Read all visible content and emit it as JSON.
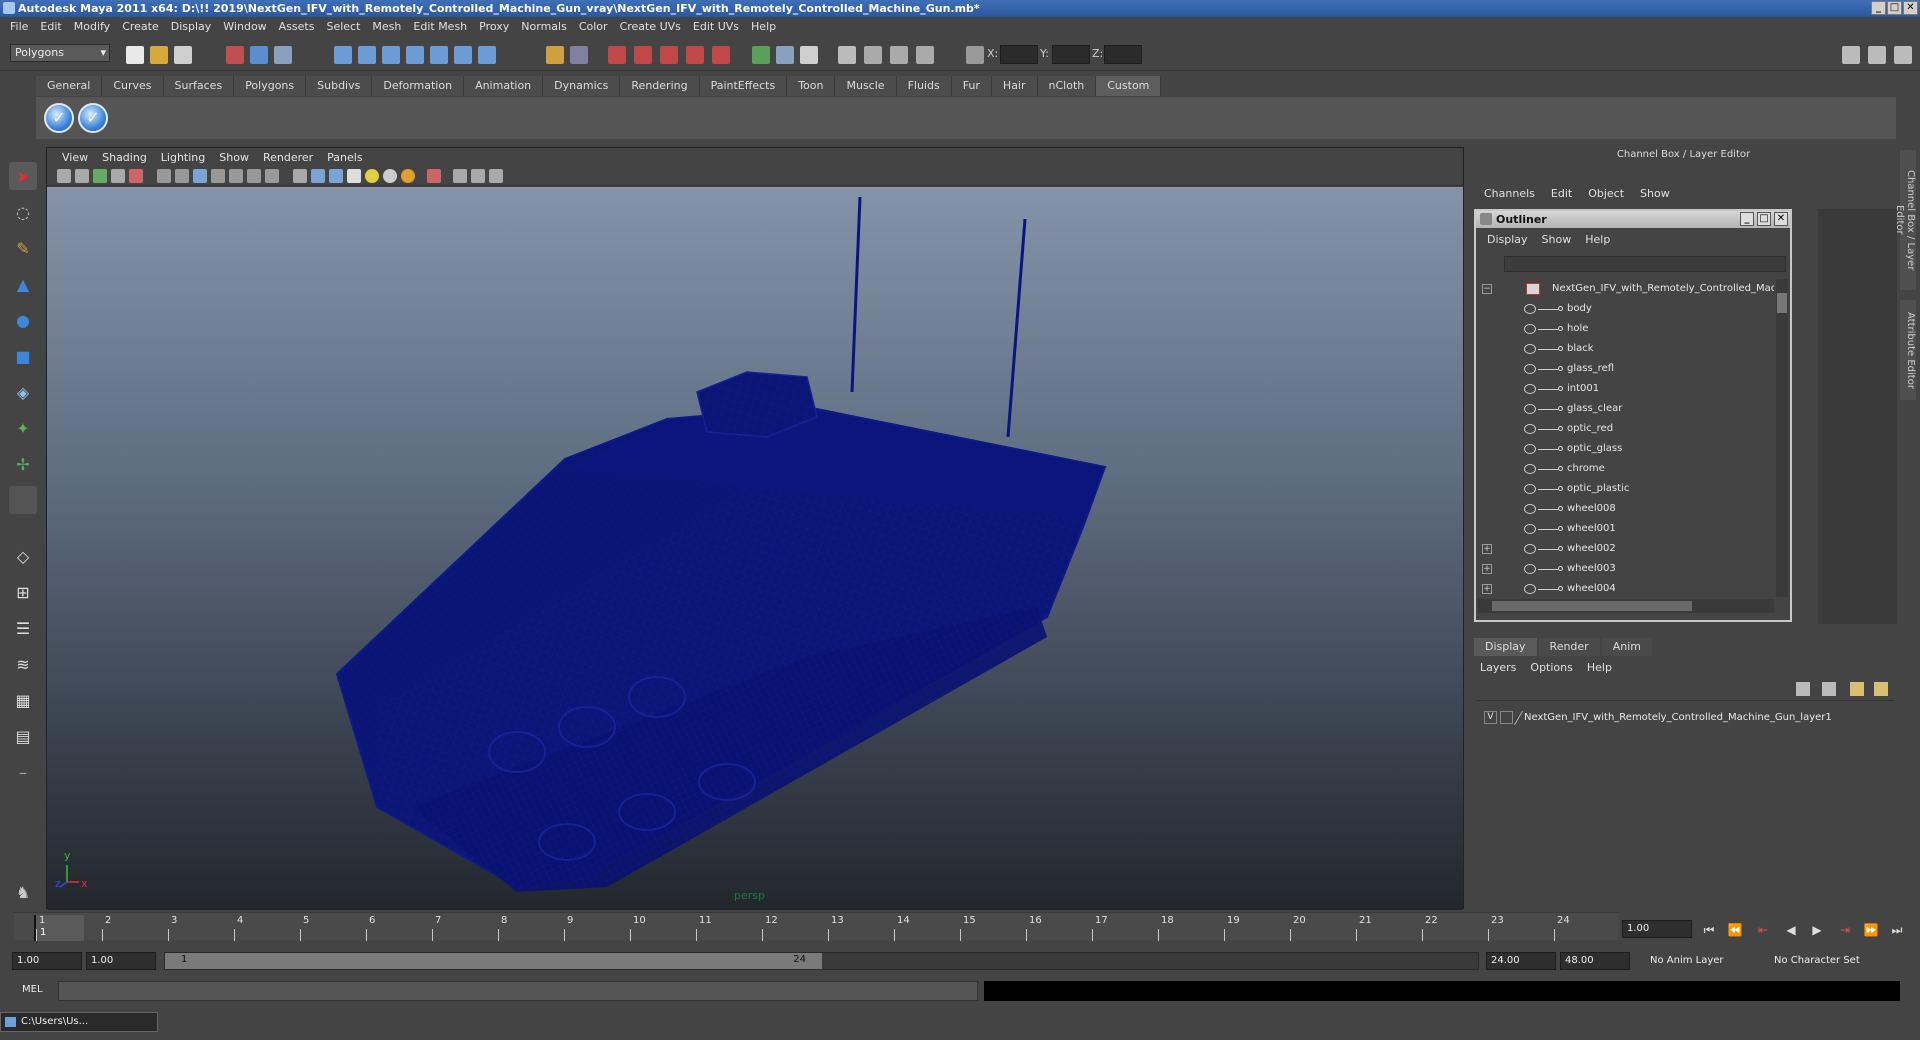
{
  "window": {
    "title": "Autodesk Maya 2011 x64: D:\\!! 2019\\NextGen_IFV_with_Remotely_Controlled_Machine_Gun_vray\\NextGen_IFV_with_Remotely_Controlled_Machine_Gun.mb*",
    "minimize": "_",
    "maximize": "□",
    "close": "✕"
  },
  "menubar": [
    "File",
    "Edit",
    "Modify",
    "Create",
    "Display",
    "Window",
    "Assets",
    "Select",
    "Mesh",
    "Edit Mesh",
    "Proxy",
    "Normals",
    "Color",
    "Create UVs",
    "Edit UVs",
    "Help"
  ],
  "statusline": {
    "mode": "Polygons",
    "x_label": "X:",
    "y_label": "Y:",
    "z_label": "Z:"
  },
  "shelf": {
    "tabs": [
      "General",
      "Curves",
      "Surfaces",
      "Polygons",
      "Subdivs",
      "Deformation",
      "Animation",
      "Dynamics",
      "Rendering",
      "PaintEffects",
      "Toon",
      "Muscle",
      "Fluids",
      "Fur",
      "Hair",
      "nCloth",
      "Custom"
    ],
    "active_tab": "Custom",
    "buttons": [
      "check-icon",
      "check-icon"
    ]
  },
  "viewport": {
    "menu": [
      "View",
      "Shading",
      "Lighting",
      "Show",
      "Renderer",
      "Panels"
    ],
    "camera_label": "persp",
    "axis_y": "y",
    "axis_x": "x",
    "axis_z": "z",
    "wire_color": "#0a1575"
  },
  "channel_box": {
    "title": "Channel Box / Layer Editor",
    "menu": [
      "Channels",
      "Edit",
      "Object",
      "Show"
    ]
  },
  "outliner": {
    "title": "Outliner",
    "menu": [
      "Display",
      "Show",
      "Help"
    ],
    "root": "NextGen_IFV_with_Remotely_Controlled_Mac",
    "items": [
      "body",
      "hole",
      "black",
      "glass_refl",
      "int001",
      "glass_clear",
      "optic_red",
      "optic_glass",
      "chrome",
      "optic_plastic",
      "wheel008",
      "wheel001",
      "wheel002",
      "wheel003",
      "wheel004"
    ],
    "expand_sign": "+",
    "collapse_sign": "−"
  },
  "layer_editor": {
    "tabs": [
      "Display",
      "Render",
      "Anim"
    ],
    "active_tab": "Display",
    "menu": [
      "Layers",
      "Options",
      "Help"
    ],
    "layer_name": "NextGen_IFV_with_Remotely_Controlled_Machine_Gun_layer1",
    "visible_mark": "V"
  },
  "side_tabs": [
    "Channel Box / Layer Editor",
    "Attribute Editor"
  ],
  "timeline": {
    "ticks": [
      "1",
      "2",
      "3",
      "4",
      "5",
      "6",
      "7",
      "8",
      "9",
      "10",
      "11",
      "12",
      "13",
      "14",
      "15",
      "16",
      "17",
      "18",
      "19",
      "20",
      "21",
      "22",
      "23",
      "24"
    ],
    "current_marker": "1",
    "current_frame": "1.00"
  },
  "range": {
    "start_time": "1.00",
    "playback_start": "1.00",
    "range_start_label": "1",
    "range_end_label": "24",
    "playback_end": "24.00",
    "end_time": "48.00",
    "anim_layer": "No Anim Layer",
    "character_set": "No Character Set"
  },
  "commandline": {
    "label": "MEL"
  },
  "taskbar": {
    "item": "C:\\Users\\Us..."
  }
}
